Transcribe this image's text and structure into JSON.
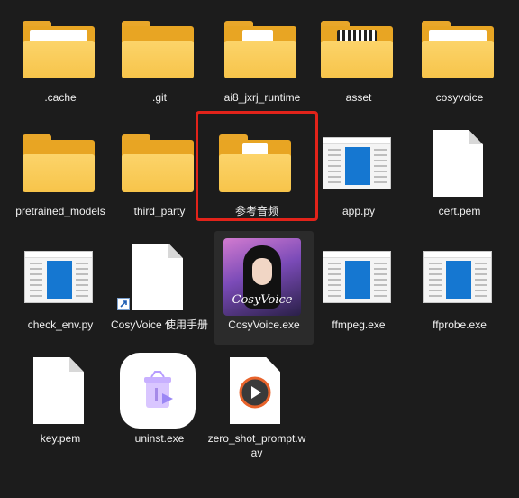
{
  "window": {
    "view": "large-icons",
    "selected_item": "参考音频"
  },
  "colors": {
    "background": "#1c1c1c",
    "folder": "#f7c44a",
    "selection": "#e2231a",
    "exe_blue": "#1577d1"
  },
  "files": [
    {
      "name": ".cache",
      "icon": "folder-icon"
    },
    {
      "name": ".git",
      "icon": "folder-icon"
    },
    {
      "name": "ai8_jxrj_runtime",
      "icon": "folder-icon"
    },
    {
      "name": "asset",
      "icon": "folder-icon"
    },
    {
      "name": "cosyvoice",
      "icon": "folder-icon"
    },
    {
      "name": "pretrained_models",
      "icon": "folder-icon"
    },
    {
      "name": "third_party",
      "icon": "folder-icon"
    },
    {
      "name": "参考音频",
      "icon": "folder-icon"
    },
    {
      "name": "app.py",
      "icon": "python-file-icon"
    },
    {
      "name": "cert.pem",
      "icon": "document-icon"
    },
    {
      "name": "check_env.py",
      "icon": "python-file-icon"
    },
    {
      "name": "CosyVoice 使用手册",
      "icon": "shortcut-document-icon"
    },
    {
      "name": "CosyVoice.exe",
      "icon": "app-icon",
      "brand": "CosyVoice"
    },
    {
      "name": "ffmpeg.exe",
      "icon": "exe-icon"
    },
    {
      "name": "ffprobe.exe",
      "icon": "exe-icon"
    },
    {
      "name": "key.pem",
      "icon": "document-icon"
    },
    {
      "name": "uninst.exe",
      "icon": "uninstaller-icon"
    },
    {
      "name": "zero_shot_prompt.wav",
      "icon": "audio-file-icon"
    }
  ]
}
